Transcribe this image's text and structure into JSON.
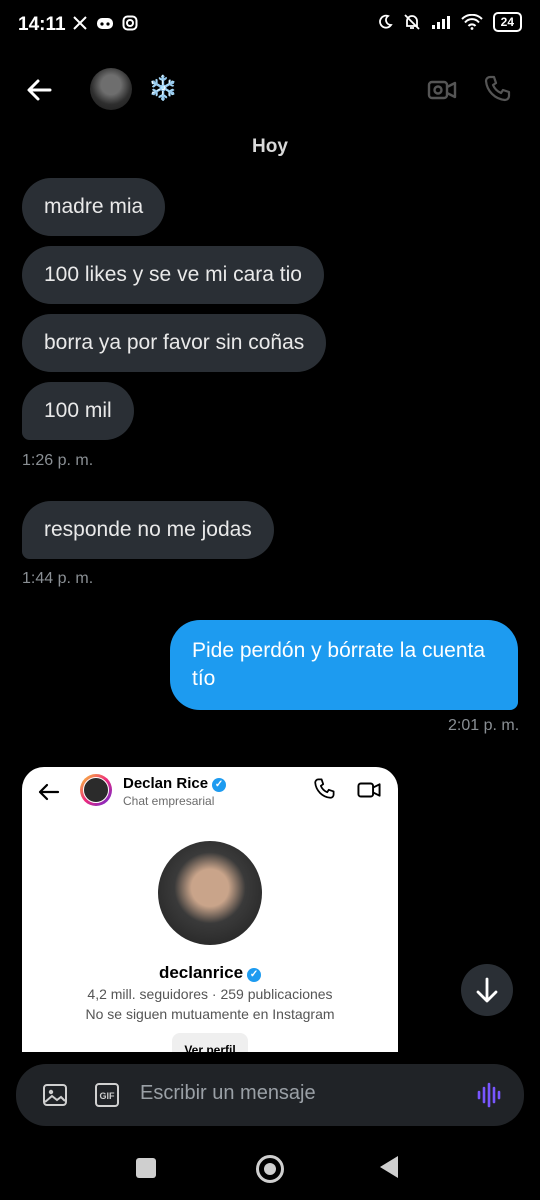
{
  "status_bar": {
    "time": "14:11",
    "battery": "24",
    "left_icons": [
      "x-icon",
      "discord-icon",
      "instagram-icon"
    ]
  },
  "header": {
    "emoji": "❄️"
  },
  "day_label": "Hoy",
  "messages": [
    {
      "text": "madre mia",
      "direction": "in"
    },
    {
      "text": "100 likes y se ve mi cara tio",
      "direction": "in"
    },
    {
      "text": "borra ya por favor sin coñas",
      "direction": "in"
    },
    {
      "text": "100 mil",
      "direction": "in"
    },
    {
      "text": "responde no me jodas",
      "direction": "in"
    },
    {
      "text": "Pide perdón y bórrate la cuenta tío",
      "direction": "out"
    }
  ],
  "timestamps": [
    "1:26 p. m.",
    "1:44 p. m.",
    "2:01 p. m."
  ],
  "shared_card": {
    "name": "Declan Rice",
    "subtitle": "Chat empresarial",
    "handle": "declanrice",
    "stats": "4,2 mill. seguidores · 259 publicaciones",
    "mutual": "No se siguen mutuamente en Instagram",
    "button": "Ver perfil"
  },
  "composer": {
    "placeholder": "Escribir un mensaje",
    "gif": "GIF"
  },
  "colors": {
    "background": "#000000",
    "incoming": "#2a2f35",
    "outgoing": "#1d9bf0",
    "voice": "#7856ff"
  }
}
